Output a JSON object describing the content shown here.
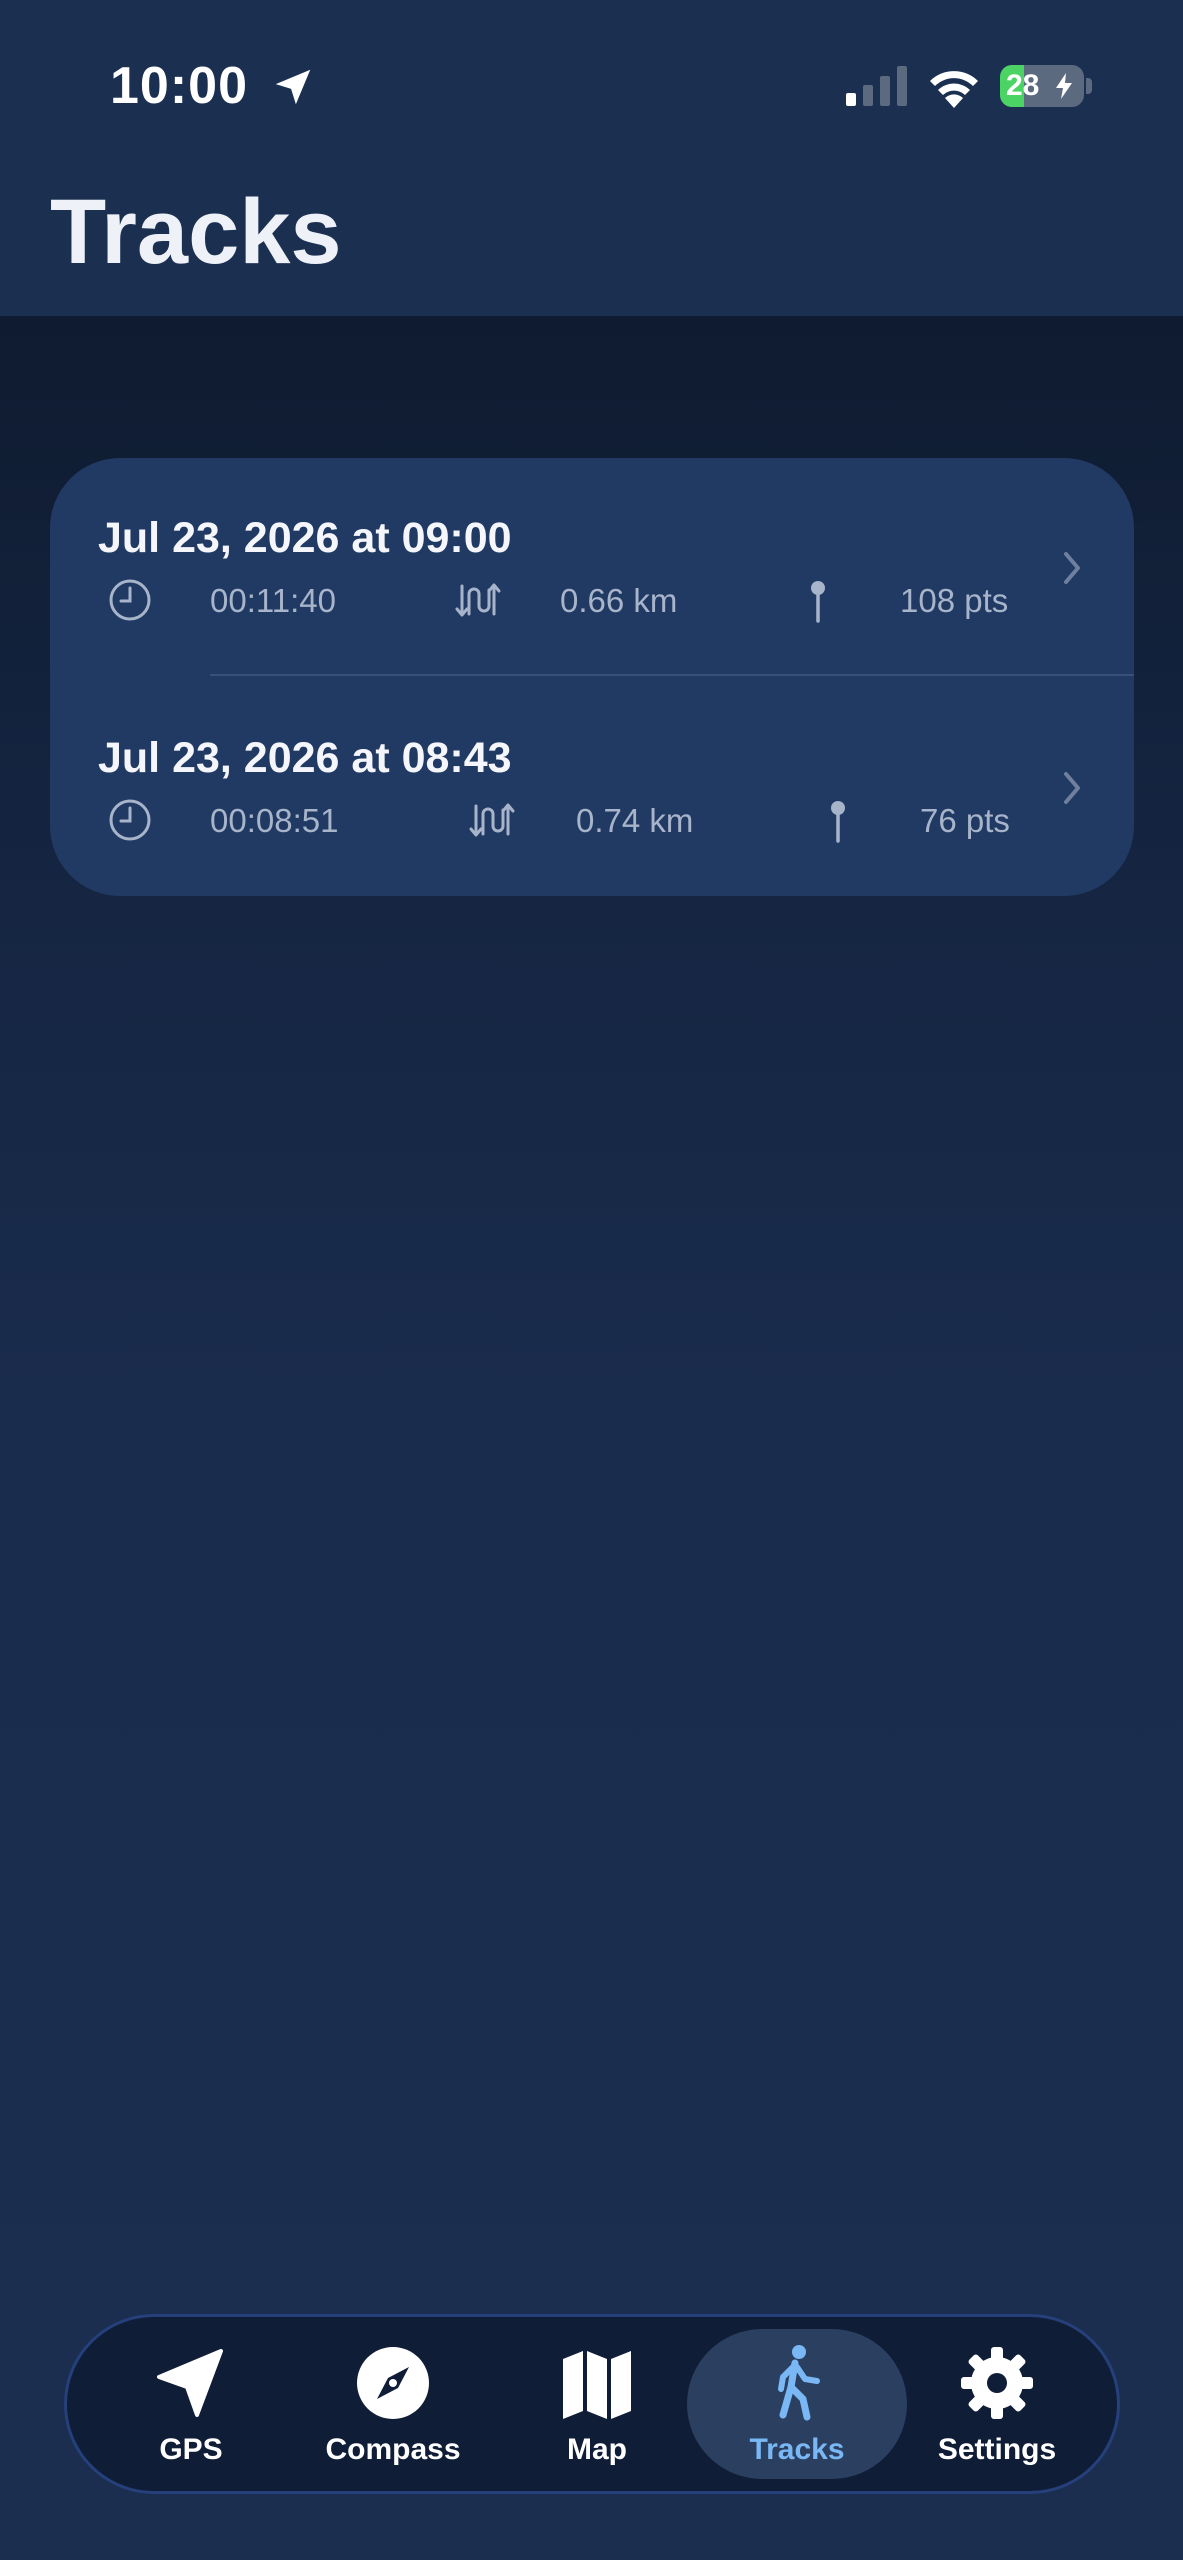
{
  "status_bar": {
    "time": "10:00",
    "battery_level": "28",
    "battery_percent": 28
  },
  "page": {
    "title": "Tracks"
  },
  "tracks": [
    {
      "title": "Jul 23, 2026 at 09:00",
      "duration": "00:11:40",
      "distance": "0.66 km",
      "points": "108 pts"
    },
    {
      "title": "Jul 23, 2026 at 08:43",
      "duration": "00:08:51",
      "distance": "0.74 km",
      "points": "76 pts"
    }
  ],
  "tab_bar": {
    "tabs": [
      {
        "label": "GPS",
        "icon": "location-arrow-icon"
      },
      {
        "label": "Compass",
        "icon": "compass-icon"
      },
      {
        "label": "Map",
        "icon": "map-icon"
      },
      {
        "label": "Tracks",
        "icon": "walking-person-icon",
        "active": true
      },
      {
        "label": "Settings",
        "icon": "gear-icon"
      }
    ]
  },
  "colors": {
    "background": "#1a2c4d",
    "card": "#213a63",
    "active_tab_accent": "#7ab8f5",
    "battery_green": "#4bd464"
  }
}
